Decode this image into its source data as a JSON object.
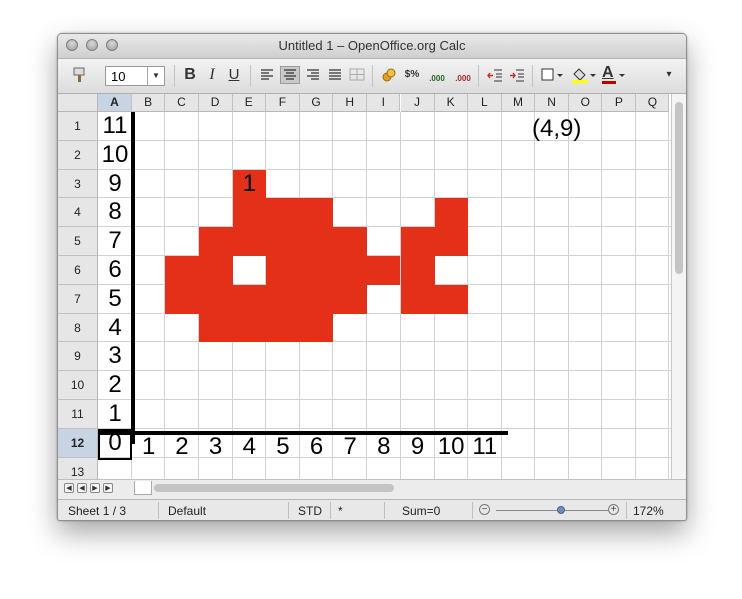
{
  "window": {
    "title": "Untitled 1 – OpenOffice.org Calc"
  },
  "toolbar": {
    "font_size": "10",
    "icons": [
      "paintbrush-icon",
      "bold-icon",
      "italic-icon",
      "underline-icon",
      "align-left-icon",
      "align-center-icon",
      "align-right-icon",
      "justify-icon",
      "merge-cells-icon",
      "currency-icon",
      "percent-icon",
      "add-decimal-icon",
      "delete-decimal-icon",
      "decrease-indent-icon",
      "increase-indent-icon",
      "borders-icon",
      "background-color-icon",
      "font-color-icon"
    ],
    "bold_glyph": "B",
    "italic_glyph": "I",
    "underline_glyph": "U",
    "font_color_glyph": "A",
    "percent_glyph": "$%",
    "add_decimal_glyph": ".000",
    "delete_decimal_glyph": ".000"
  },
  "columns": [
    "A",
    "B",
    "C",
    "D",
    "E",
    "F",
    "G",
    "H",
    "I",
    "J",
    "K",
    "L",
    "M",
    "N",
    "O",
    "P",
    "Q"
  ],
  "rows": [
    "1",
    "2",
    "3",
    "4",
    "5",
    "6",
    "7",
    "8",
    "9",
    "10",
    "11",
    "12",
    "13"
  ],
  "selected_cell": "A12",
  "grid": {
    "y_labels": [
      "11",
      "10",
      "9",
      "8",
      "7",
      "6",
      "5",
      "4",
      "3",
      "2",
      "1",
      "0"
    ],
    "x_labels": [
      "1",
      "2",
      "3",
      "4",
      "5",
      "6",
      "7",
      "8",
      "9",
      "10",
      "11"
    ],
    "annotation": "(4,9)",
    "cell_value_e3": "1",
    "red_cells": [
      "E3",
      "E4",
      "F4",
      "G4",
      "K4",
      "D5",
      "E5",
      "F5",
      "G5",
      "H5",
      "J5",
      "K5",
      "C6",
      "D6",
      "F6",
      "G6",
      "H6",
      "I6",
      "J6",
      "C7",
      "D7",
      "E7",
      "F7",
      "G7",
      "H7",
      "J7",
      "K7",
      "D8",
      "E8",
      "F8",
      "G8"
    ],
    "fill_color": "#e53019"
  },
  "status": {
    "sheet": "Sheet 1 / 3",
    "style": "Default",
    "mode": "STD",
    "modified": "*",
    "sum": "Sum=0",
    "zoom": "172%",
    "zoom_level_percent": 172
  }
}
